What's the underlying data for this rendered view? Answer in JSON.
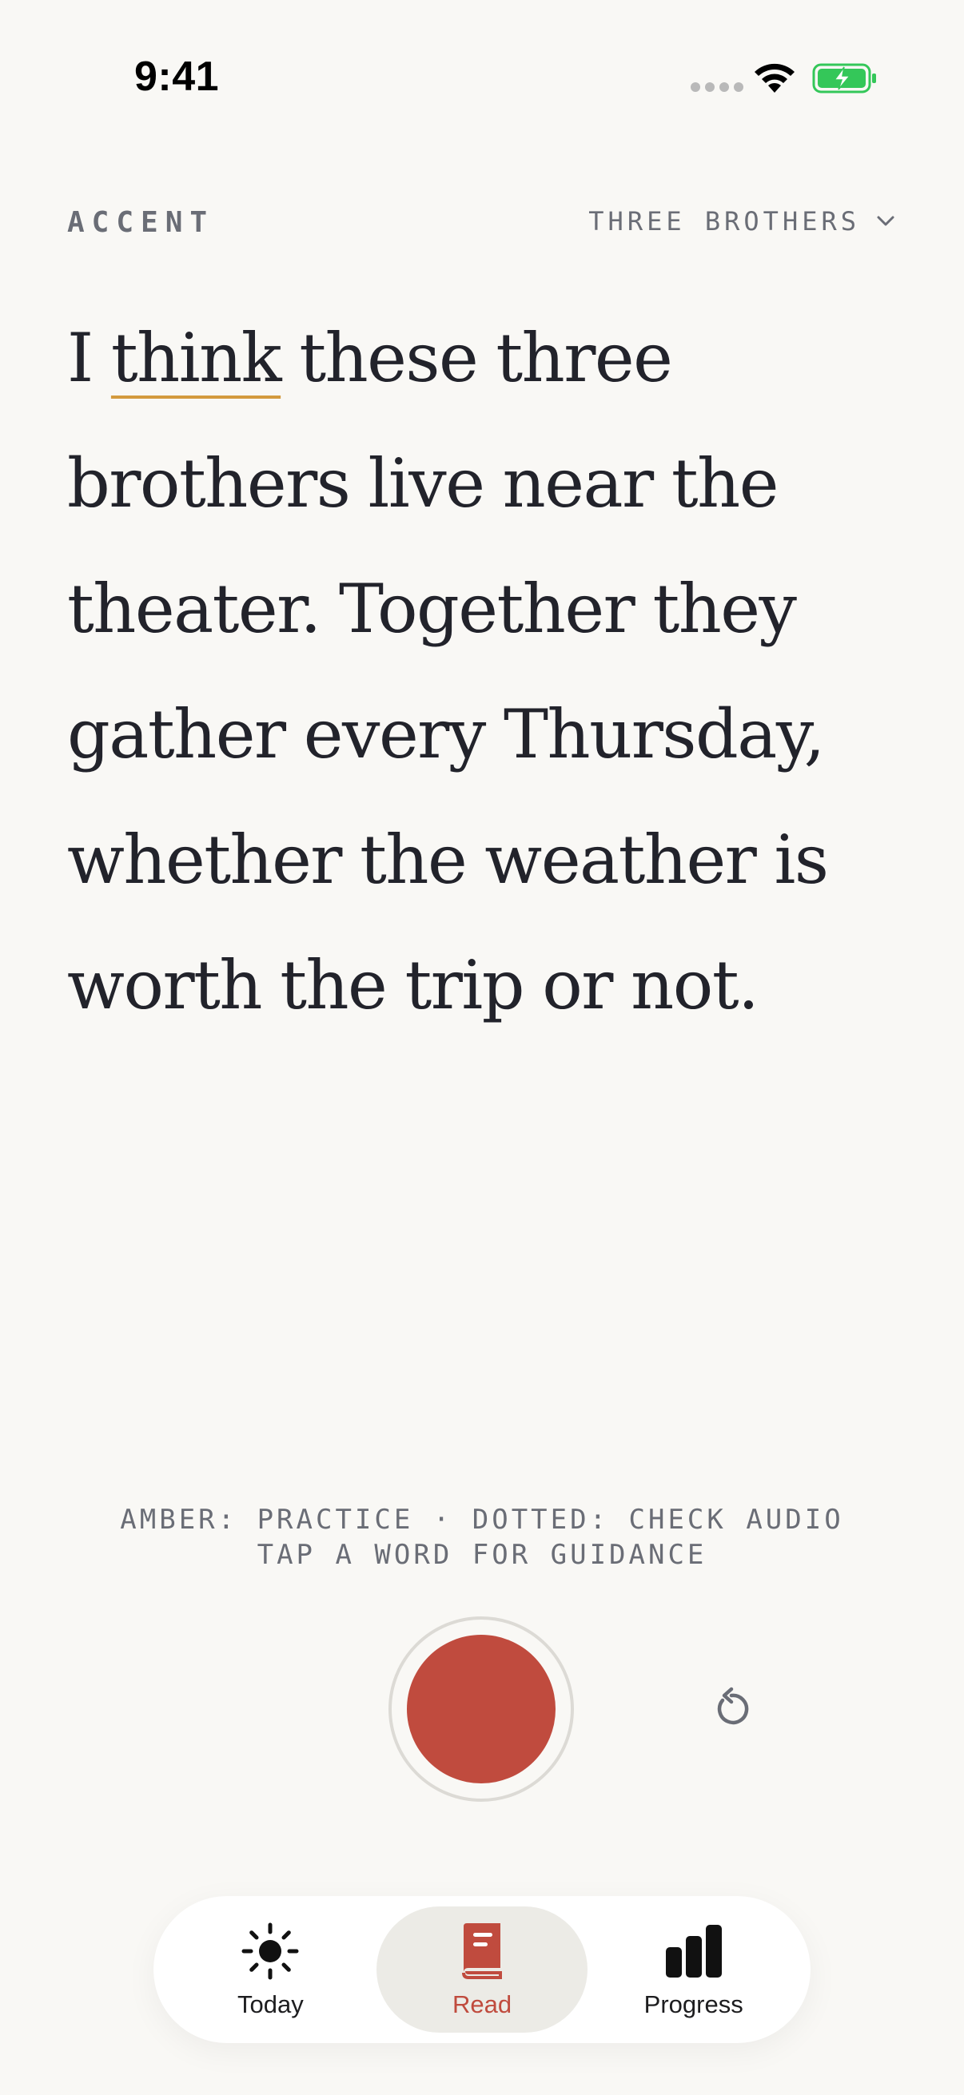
{
  "status_bar": {
    "time": "9:41"
  },
  "header": {
    "app_label": "ACCENT",
    "passage_selector": "THREE BROTHERS"
  },
  "passage": {
    "words": [
      "I",
      "think",
      "these",
      "three",
      "brothers",
      "live",
      "near",
      "the",
      "theater.",
      "Together",
      "they",
      "gather",
      "every",
      "Thursday,",
      "whether",
      "the",
      "weather",
      "is",
      "worth",
      "the",
      "trip",
      "or",
      "not."
    ],
    "practice_words": [
      "think"
    ]
  },
  "legend": {
    "line1": "AMBER: PRACTICE · DOTTED: CHECK AUDIO",
    "line2": "TAP A WORD FOR GUIDANCE"
  },
  "colors": {
    "accent_red": "#c04b3e",
    "practice_amber": "#d39a3e",
    "text": "#22232b",
    "muted": "#6a6d76",
    "background": "#f9f8f5"
  },
  "tab_bar": {
    "tabs": [
      {
        "label": "Today",
        "icon": "sun-icon",
        "active": false
      },
      {
        "label": "Read",
        "icon": "book-icon",
        "active": true
      },
      {
        "label": "Progress",
        "icon": "bar-chart-icon",
        "active": false
      }
    ]
  }
}
